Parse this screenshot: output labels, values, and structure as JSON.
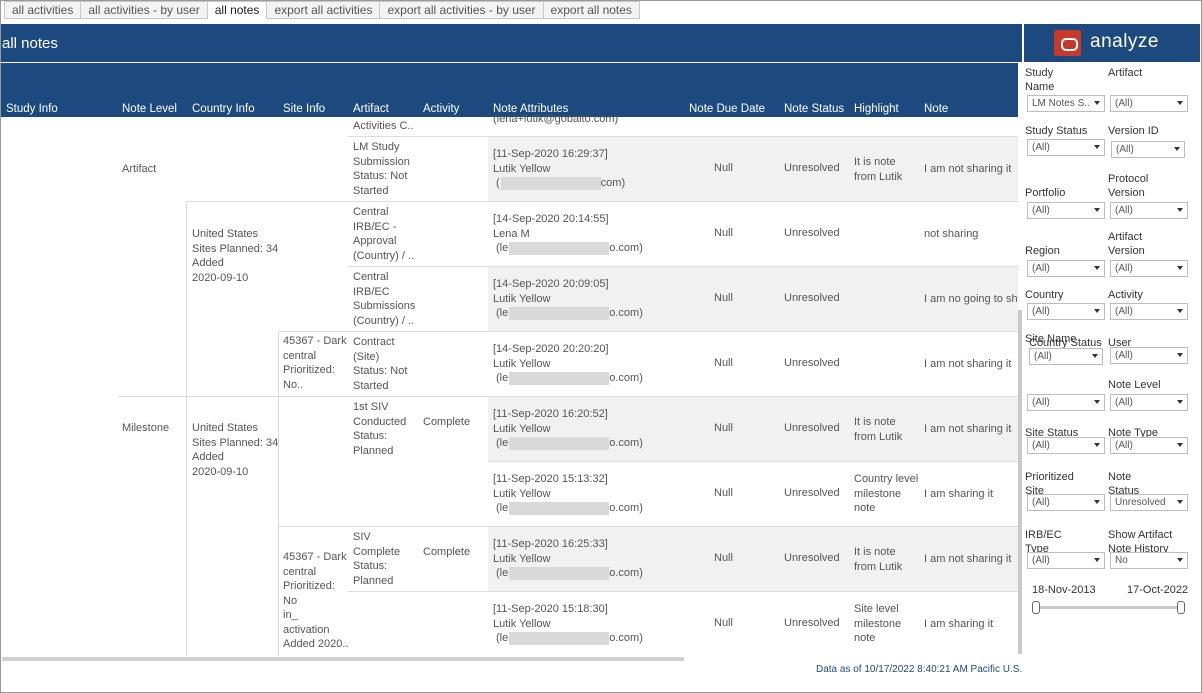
{
  "tabs": [
    "all activities",
    "all activities - by user",
    "all notes",
    "export all activities",
    "export all activities - by user",
    "export all notes"
  ],
  "active_tab": 2,
  "title": "all notes",
  "brand": "analyze",
  "headers": [
    "Study Info",
    "Note Level",
    "Country Info",
    "Site Info",
    "Artifact",
    "Activity",
    "Note Attributes",
    "Note Due Date",
    "Note Status",
    "Highlight",
    "Note"
  ],
  "top_partial": {
    "artifact": "Activities C..",
    "attr": "lena+lutik@gobalto.com)"
  },
  "groups": {
    "note_level_1": "Artifact",
    "note_level_2": "Milestone",
    "country_1": [
      "United States",
      "Sites Planned: 34",
      "Added",
      "2020-09-10"
    ],
    "country_2": [
      "United States",
      "Sites Planned: 34",
      "Added",
      "2020-09-10"
    ],
    "site_1": [
      "45367 - Dark",
      "central",
      "Prioritized:",
      "No.."
    ],
    "site_2": [
      "45367 - Dark",
      "central",
      "Prioritized:",
      "No",
      "in_",
      "activation",
      "Added 2020.."
    ]
  },
  "rows": [
    {
      "artifact": [
        "LM Study",
        "Submission",
        "Status: Not",
        "Started"
      ],
      "activity": "",
      "ts": "[11-Sep-2020 16:29:37]",
      "user": "Lutik Yellow",
      "email_pre": "(",
      "email_post": "com)",
      "due": "Null",
      "status": "Unresolved",
      "highlight": [
        "It is note",
        "from Lutik"
      ],
      "note": "I am not sharing it"
    },
    {
      "artifact": [
        "Central",
        "IRB/EC -",
        "Approval",
        "(Country) / .."
      ],
      "activity": "",
      "ts": "[14-Sep-2020 20:14:55]",
      "user": "Lena M",
      "email_pre": "(le",
      "email_post": "o.com)",
      "due": "Null",
      "status": "Unresolved",
      "highlight": [],
      "note": "not sharing"
    },
    {
      "artifact": [
        "Central",
        "IRB/EC",
        "Submissions",
        "(Country) / .."
      ],
      "activity": "",
      "ts": "[14-Sep-2020 20:09:05]",
      "user": "Lutik Yellow",
      "email_pre": "(le",
      "email_post": "o.com)",
      "due": "Null",
      "status": "Unresolved",
      "highlight": [],
      "note": "I am no going to sh"
    },
    {
      "artifact": [
        "Contract",
        "(Site)",
        "Status: Not",
        "Started"
      ],
      "activity": "",
      "ts": "[14-Sep-2020 20:20:20]",
      "user": "Lutik Yellow",
      "email_pre": "(le",
      "email_post": "o.com)",
      "due": "Null",
      "status": "Unresolved",
      "highlight": [],
      "note": "I am not sharing it"
    },
    {
      "artifact": [
        "1st SIV",
        "Conducted",
        "Status:",
        "Planned"
      ],
      "activity": "Complete",
      "ts": "[11-Sep-2020 16:20:52]",
      "user": "Lutik Yellow",
      "email_pre": "(le",
      "email_post": "o.com)",
      "due": "Null",
      "status": "Unresolved",
      "highlight": [
        "It is note",
        "from Lutik"
      ],
      "note": "I am not sharing it"
    },
    {
      "artifact": [],
      "activity": "",
      "ts": "[11-Sep-2020 15:13:32]",
      "user": "Lutik Yellow",
      "email_pre": "(le",
      "email_post": "o.com)",
      "due": "Null",
      "status": "Unresolved",
      "highlight": [
        "Country level",
        "milestone",
        "note"
      ],
      "note": "I am sharing it"
    },
    {
      "artifact": [
        "SIV",
        "Complete",
        "Status:",
        "Planned"
      ],
      "activity": "Complete",
      "ts": "[11-Sep-2020 16:25:33]",
      "user": "Lutik Yellow",
      "email_pre": "(le",
      "email_post": "o.com)",
      "due": "Null",
      "status": "Unresolved",
      "highlight": [
        "It is note",
        "from Lutik"
      ],
      "note": "I am not sharing it"
    },
    {
      "artifact": [],
      "activity": "",
      "ts": "[11-Sep-2020 15:18:30]",
      "user": "Lutik Yellow",
      "email_pre": "(le",
      "email_post": "o.com)",
      "due": "Null",
      "status": "Unresolved",
      "highlight": [
        "Site level",
        "milestone",
        "note"
      ],
      "note": "I am sharing it"
    }
  ],
  "filters": [
    {
      "label": [
        "Study",
        "Name"
      ],
      "value": "LM Notes S..",
      "col": 0
    },
    {
      "label": [
        "Artifact"
      ],
      "value": "(All)",
      "col": 1
    },
    {
      "label": [
        "Study Status"
      ],
      "value": "(All)",
      "col": 0
    },
    {
      "label": [
        "Version ID"
      ],
      "value": "(All)",
      "col": 1
    },
    {
      "label": [
        "Portfolio"
      ],
      "value": "(All)",
      "col": 0
    },
    {
      "label": [
        "Protocol",
        "Version"
      ],
      "value": "(All)",
      "col": 1
    },
    {
      "label": [
        "Region"
      ],
      "value": "(All)",
      "col": 0
    },
    {
      "label": [
        "Artifact",
        "Version"
      ],
      "value": "(All)",
      "col": 1
    },
    {
      "label": [
        "Country"
      ],
      "value": "(All)",
      "col": 0
    },
    {
      "label": [
        "Activity"
      ],
      "value": "(All)",
      "col": 1
    },
    {
      "label": [
        "Country Status"
      ],
      "value": "(All)",
      "col": 0
    },
    {
      "label": [
        "User"
      ],
      "value": "(All)",
      "col": 1
    },
    {
      "label": [
        "Site Name"
      ],
      "value": "(All)",
      "col": 0
    },
    {
      "label": [
        "Note Level"
      ],
      "value": "(All)",
      "col": 1
    },
    {
      "label": [
        "Site Status"
      ],
      "value": "(All)",
      "col": 0
    },
    {
      "label": [
        "Note Type"
      ],
      "value": "(All)",
      "col": 1
    },
    {
      "label": [
        "Prioritized",
        "Site"
      ],
      "value": "(All)",
      "col": 0
    },
    {
      "label": [
        "Note",
        "Status"
      ],
      "value": "Unresolved",
      "col": 1
    },
    {
      "label": [
        "IRB/EC",
        "Type"
      ],
      "value": "(All)",
      "col": 0
    },
    {
      "label": [
        "Show Artifact",
        "Note History"
      ],
      "value": "No",
      "col": 1
    }
  ],
  "date_range": {
    "start": "18-Nov-2013",
    "end": "17-Oct-2022"
  },
  "footer": "Data as of 10/17/2022 8:40:21 AM Pacific U.S."
}
